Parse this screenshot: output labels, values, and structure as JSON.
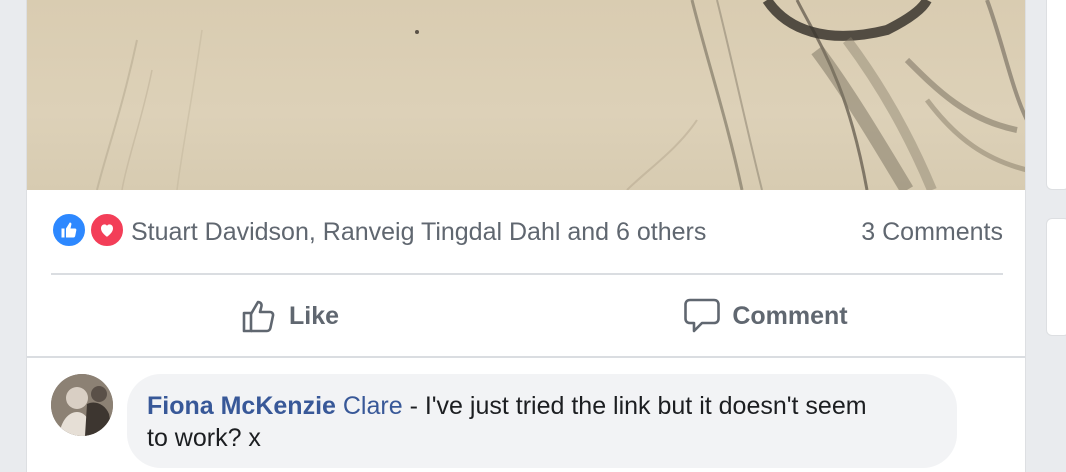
{
  "post": {
    "photo_alt": "pencil-sketch-photo",
    "reactions": {
      "icons": [
        "like-icon",
        "love-icon"
      ],
      "names_text": "Stuart Davidson, Ranveig Tingdal Dahl and 6 others",
      "comments_count_text": "3 Comments"
    },
    "actions": {
      "like_label": "Like",
      "comment_label": "Comment"
    },
    "comments": [
      {
        "author": "Fiona McKenzie",
        "mention": "Clare",
        "text_line1": " - I've just tried the link but it doesn't seem",
        "text_line2": "to work? x"
      }
    ]
  },
  "colors": {
    "like_blue": "#2d88ff",
    "love_red": "#f33e58",
    "link_blue": "#385898",
    "secondary_text": "#606770"
  }
}
